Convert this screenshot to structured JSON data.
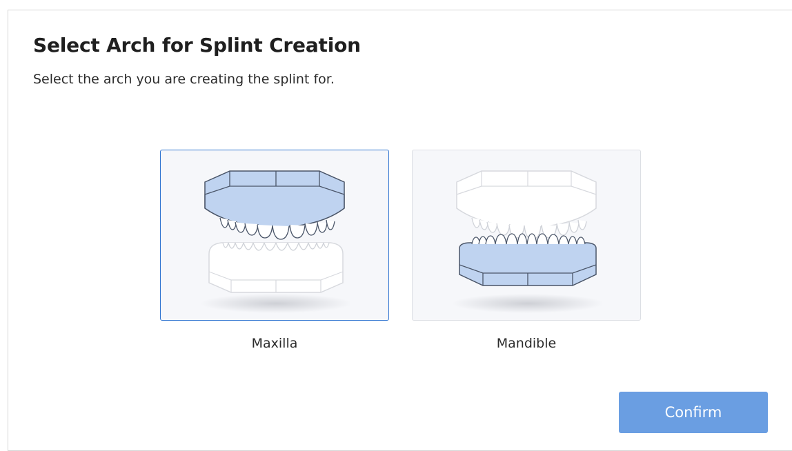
{
  "dialog": {
    "title": "Select Arch for Splint Creation",
    "subtitle": "Select the arch you are creating the splint for."
  },
  "options": [
    {
      "label": "Maxilla",
      "selected": true,
      "illustration": "upper-arch-splint-icon"
    },
    {
      "label": "Mandible",
      "selected": false,
      "illustration": "lower-arch-splint-icon"
    }
  ],
  "actions": {
    "confirm_label": "Confirm"
  },
  "colors": {
    "accent": "#2f74d0",
    "button": "#6a9ee2",
    "splint_fill": "#bfd3f0",
    "card_bg": "#f6f7fa"
  }
}
